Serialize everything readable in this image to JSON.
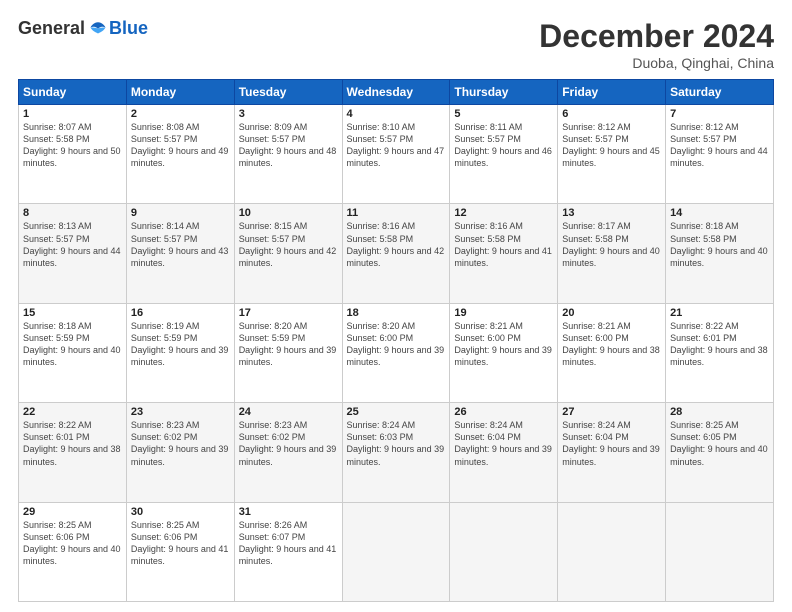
{
  "header": {
    "logo_general": "General",
    "logo_blue": "Blue",
    "month_title": "December 2024",
    "location": "Duoba, Qinghai, China"
  },
  "days_of_week": [
    "Sunday",
    "Monday",
    "Tuesday",
    "Wednesday",
    "Thursday",
    "Friday",
    "Saturday"
  ],
  "weeks": [
    [
      {
        "day": "1",
        "sunrise": "8:07 AM",
        "sunset": "5:58 PM",
        "daylight": "9 hours and 50 minutes."
      },
      {
        "day": "2",
        "sunrise": "8:08 AM",
        "sunset": "5:57 PM",
        "daylight": "9 hours and 49 minutes."
      },
      {
        "day": "3",
        "sunrise": "8:09 AM",
        "sunset": "5:57 PM",
        "daylight": "9 hours and 48 minutes."
      },
      {
        "day": "4",
        "sunrise": "8:10 AM",
        "sunset": "5:57 PM",
        "daylight": "9 hours and 47 minutes."
      },
      {
        "day": "5",
        "sunrise": "8:11 AM",
        "sunset": "5:57 PM",
        "daylight": "9 hours and 46 minutes."
      },
      {
        "day": "6",
        "sunrise": "8:12 AM",
        "sunset": "5:57 PM",
        "daylight": "9 hours and 45 minutes."
      },
      {
        "day": "7",
        "sunrise": "8:12 AM",
        "sunset": "5:57 PM",
        "daylight": "9 hours and 44 minutes."
      }
    ],
    [
      {
        "day": "8",
        "sunrise": "8:13 AM",
        "sunset": "5:57 PM",
        "daylight": "9 hours and 44 minutes."
      },
      {
        "day": "9",
        "sunrise": "8:14 AM",
        "sunset": "5:57 PM",
        "daylight": "9 hours and 43 minutes."
      },
      {
        "day": "10",
        "sunrise": "8:15 AM",
        "sunset": "5:57 PM",
        "daylight": "9 hours and 42 minutes."
      },
      {
        "day": "11",
        "sunrise": "8:16 AM",
        "sunset": "5:58 PM",
        "daylight": "9 hours and 42 minutes."
      },
      {
        "day": "12",
        "sunrise": "8:16 AM",
        "sunset": "5:58 PM",
        "daylight": "9 hours and 41 minutes."
      },
      {
        "day": "13",
        "sunrise": "8:17 AM",
        "sunset": "5:58 PM",
        "daylight": "9 hours and 40 minutes."
      },
      {
        "day": "14",
        "sunrise": "8:18 AM",
        "sunset": "5:58 PM",
        "daylight": "9 hours and 40 minutes."
      }
    ],
    [
      {
        "day": "15",
        "sunrise": "8:18 AM",
        "sunset": "5:59 PM",
        "daylight": "9 hours and 40 minutes."
      },
      {
        "day": "16",
        "sunrise": "8:19 AM",
        "sunset": "5:59 PM",
        "daylight": "9 hours and 39 minutes."
      },
      {
        "day": "17",
        "sunrise": "8:20 AM",
        "sunset": "5:59 PM",
        "daylight": "9 hours and 39 minutes."
      },
      {
        "day": "18",
        "sunrise": "8:20 AM",
        "sunset": "6:00 PM",
        "daylight": "9 hours and 39 minutes."
      },
      {
        "day": "19",
        "sunrise": "8:21 AM",
        "sunset": "6:00 PM",
        "daylight": "9 hours and 39 minutes."
      },
      {
        "day": "20",
        "sunrise": "8:21 AM",
        "sunset": "6:00 PM",
        "daylight": "9 hours and 38 minutes."
      },
      {
        "day": "21",
        "sunrise": "8:22 AM",
        "sunset": "6:01 PM",
        "daylight": "9 hours and 38 minutes."
      }
    ],
    [
      {
        "day": "22",
        "sunrise": "8:22 AM",
        "sunset": "6:01 PM",
        "daylight": "9 hours and 38 minutes."
      },
      {
        "day": "23",
        "sunrise": "8:23 AM",
        "sunset": "6:02 PM",
        "daylight": "9 hours and 39 minutes."
      },
      {
        "day": "24",
        "sunrise": "8:23 AM",
        "sunset": "6:02 PM",
        "daylight": "9 hours and 39 minutes."
      },
      {
        "day": "25",
        "sunrise": "8:24 AM",
        "sunset": "6:03 PM",
        "daylight": "9 hours and 39 minutes."
      },
      {
        "day": "26",
        "sunrise": "8:24 AM",
        "sunset": "6:04 PM",
        "daylight": "9 hours and 39 minutes."
      },
      {
        "day": "27",
        "sunrise": "8:24 AM",
        "sunset": "6:04 PM",
        "daylight": "9 hours and 39 minutes."
      },
      {
        "day": "28",
        "sunrise": "8:25 AM",
        "sunset": "6:05 PM",
        "daylight": "9 hours and 40 minutes."
      }
    ],
    [
      {
        "day": "29",
        "sunrise": "8:25 AM",
        "sunset": "6:06 PM",
        "daylight": "9 hours and 40 minutes."
      },
      {
        "day": "30",
        "sunrise": "8:25 AM",
        "sunset": "6:06 PM",
        "daylight": "9 hours and 41 minutes."
      },
      {
        "day": "31",
        "sunrise": "8:26 AM",
        "sunset": "6:07 PM",
        "daylight": "9 hours and 41 minutes."
      },
      null,
      null,
      null,
      null
    ]
  ],
  "labels": {
    "sunrise": "Sunrise:",
    "sunset": "Sunset:",
    "daylight": "Daylight:"
  }
}
